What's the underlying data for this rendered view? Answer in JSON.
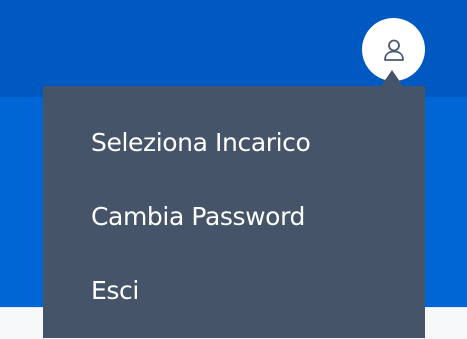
{
  "header": {
    "user_icon": "user-icon",
    "colors": {
      "bar": "#0059c1",
      "sub_bar": "#0066d6"
    }
  },
  "user_menu": {
    "background": "#455468",
    "items": [
      {
        "label": "Seleziona Incarico"
      },
      {
        "label": "Cambia Password"
      },
      {
        "label": "Esci"
      }
    ]
  }
}
